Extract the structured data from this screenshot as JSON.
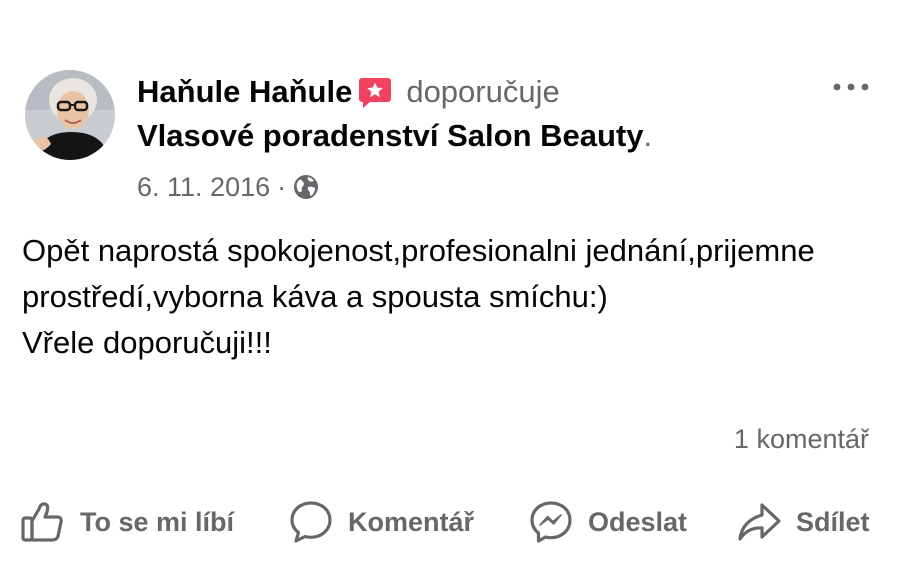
{
  "post": {
    "author": "Haňule Haňule",
    "verb": "doporučuje",
    "page_name": "Vlasové poradenství Salon Beauty",
    "page_suffix": ".",
    "date": "6. 11. 2016",
    "separator": "·",
    "privacy_icon": "globe-icon",
    "recommend_icon": "star-badge-icon",
    "body": [
      "Opět naprostá spokojenost,profesionalni jednání,prijemne prostředí,vyborna káva a spousta smíchu:)",
      "Vřele doporučuji!!!"
    ],
    "comments_count": "1 komentář"
  },
  "actions": {
    "like": "To se mi líbí",
    "comment": "Komentář",
    "send": "Odeslat",
    "share": "Sdílet"
  },
  "colors": {
    "text_primary": "#050505",
    "text_secondary": "#65676b",
    "recommend_badge": "#f3425f",
    "background": "#ffffff"
  }
}
